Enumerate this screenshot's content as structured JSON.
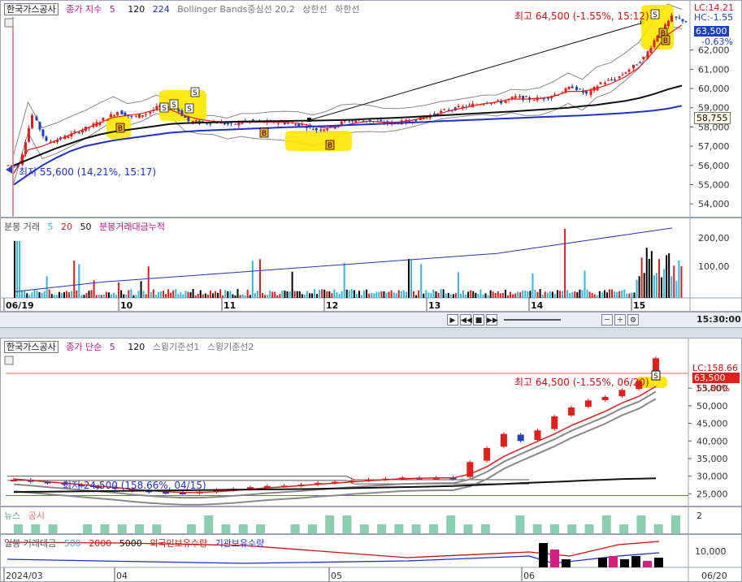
{
  "colors": {
    "up": "#e0201c",
    "down": "#1f3fbf",
    "ma5": "#e0201c",
    "ma120": "#111111",
    "ma224": "#1f2fcf",
    "bb": "#888888",
    "vol_up": "#d62020",
    "vol_down": "#000000",
    "vol_light": "#36b5d8",
    "cum": "#2233bb",
    "news": "#8ccfb0",
    "highlight": "#ffe800"
  },
  "top": {
    "legend": {
      "stock": "한국가스공사",
      "ma_label": "종가 지수",
      "p1": "5",
      "p2": "120",
      "p3": "224",
      "bb": "Bollinger Bands중심선 20,2",
      "upper": "상한선",
      "lower": "하한선"
    },
    "high_label": "최고 64,500 (-1.55%, 15:12)",
    "low_label": "최저 55,600 (14,21%, 15:17)",
    "lc": "LC:14.21",
    "hc": "HC:-1.55",
    "cur_price": "63,500",
    "cur_pct": "-0.63%",
    "ref_price": "58,755",
    "y_ticks": [
      "62,000",
      "61,000",
      "60,000",
      "59,000",
      "58,000",
      "57,000",
      "56,000",
      "55,000",
      "54,000"
    ],
    "x_ticks": [
      "06/19",
      "10",
      "11",
      "12",
      "13",
      "14",
      "15"
    ],
    "time_label": "15:30:00",
    "signal_s": "S",
    "signal_b": "B"
  },
  "vol": {
    "legend": {
      "name": "분봉 거래",
      "p1": "5",
      "p2": "20",
      "p3": "50",
      "cum": "분봉거래대금누적"
    },
    "y_ticks": [
      "200,00",
      "100,00"
    ]
  },
  "bottom": {
    "legend": {
      "stock": "한국가스공사",
      "ma_label": "종가 단순",
      "p1": "5",
      "p2": "120",
      "s1": "스윙기준선1",
      "s2": "스윙기준선2"
    },
    "high_label": "최고 64,500 (-1.55%, 06/20)",
    "low_label": "최저 24,500 (158.66%, 04/15)",
    "lc": "LC:158.66",
    "cur_price": "63,500",
    "cur_pct": "13.80%",
    "y_ticks": [
      "55,000",
      "50,000",
      "45,000",
      "40,000",
      "35,000",
      "30,000",
      "25,000"
    ],
    "x_ticks": [
      "2024/03",
      "04",
      "05",
      "06"
    ],
    "end_label": "06/20",
    "signal_s": "S"
  },
  "news": {
    "legend": {
      "news": "뉴스",
      "disc": "공시"
    },
    "y_tick": "2"
  },
  "dvol": {
    "legend": {
      "name": "일봉 거래대금",
      "p1": "500",
      "p2": "2000",
      "p3": "5000",
      "foreign": "외국인보유수량",
      "inst": "기관보유수량"
    },
    "y_tick": "10,000"
  },
  "chart_data": [
    {
      "type": "candlestick",
      "title": "한국가스공사 분봉",
      "x": [
        "06/19",
        "10",
        "11",
        "12",
        "13",
        "14",
        "15"
      ],
      "ylim": [
        53500,
        63800
      ],
      "series": [
        {
          "name": "종가",
          "values": [
            56000,
            58600,
            57200,
            57400,
            57700,
            58000,
            58400,
            58800,
            58500,
            58700,
            59100,
            59000,
            58300,
            58200,
            58250,
            58100,
            58300,
            58250,
            58250,
            58200,
            58100,
            57850,
            58000,
            58300,
            58350,
            58300,
            58200,
            58250,
            58400,
            58600,
            58850,
            59000,
            59150,
            59300,
            59300,
            59550,
            59450,
            59500,
            59750,
            60100,
            59700,
            60300,
            60500,
            61000,
            61600,
            62800,
            63700,
            63500
          ]
        },
        {
          "name": "5",
          "values": [
            55600,
            56800,
            57000,
            57300,
            57600,
            57900,
            58200,
            58500,
            58600,
            58700,
            58900,
            58900,
            58600,
            58400,
            58300,
            58250,
            58250,
            58250,
            58250,
            58250,
            58200,
            58050,
            57950,
            58050,
            58200,
            58300,
            58250,
            58250,
            58350,
            58500,
            58700,
            58900,
            59050,
            59200,
            59300,
            59450,
            59450,
            59480,
            59600,
            59850,
            59850,
            60000,
            60250,
            60600,
            61100,
            61900,
            62800,
            63300
          ]
        },
        {
          "name": "120",
          "values": [
            56000,
            56300,
            56600,
            56900,
            57150,
            57400,
            57600,
            57750,
            57850,
            57950,
            58050,
            58150,
            58200,
            58220,
            58240,
            58260,
            58280,
            58290,
            58300,
            58310,
            58320,
            58330,
            58340,
            58360,
            58380,
            58420,
            58450,
            58480,
            58520,
            58560,
            58600,
            58640,
            58680,
            58720,
            58760,
            58800,
            58850,
            58900,
            58950,
            59000,
            59080,
            59150,
            59250,
            59350,
            59500,
            59700,
            59950,
            60150
          ]
        },
        {
          "name": "224",
          "values": [
            55000,
            55500,
            56000,
            56400,
            56750,
            57000,
            57150,
            57300,
            57400,
            57500,
            57600,
            57700,
            57750,
            57800,
            57830,
            57860,
            57890,
            57920,
            57950,
            57980,
            58000,
            58020,
            58050,
            58080,
            58110,
            58140,
            58170,
            58200,
            58230,
            58260,
            58300,
            58330,
            58360,
            58390,
            58420,
            58450,
            58480,
            58510,
            58540,
            58570,
            58600,
            58640,
            58680,
            58720,
            58780,
            58850,
            58950,
            59100
          ]
        }
      ]
    },
    {
      "type": "bar",
      "title": "분봉 거래",
      "y_ticks": [
        100,
        200
      ],
      "series": [
        {
          "name": "분봉거래대금누적",
          "values": [
            20,
            35,
            50,
            60,
            70,
            80,
            90,
            100,
            110,
            120,
            130,
            140,
            160,
            180,
            200,
            220
          ]
        }
      ]
    },
    {
      "type": "candlestick",
      "title": "한국가스공사 일봉",
      "x": [
        "2024/03",
        "04",
        "05",
        "06",
        "06/20"
      ],
      "ylim": [
        23000,
        64500
      ],
      "series": [
        {
          "name": "종가",
          "values": [
            29000,
            28400,
            28100,
            27600,
            27100,
            26900,
            26400,
            25900,
            25500,
            25300,
            25200,
            25600,
            26100,
            26400,
            26900,
            27200,
            27300,
            27600,
            28100,
            28400,
            28800,
            29100,
            29300,
            29600,
            29500,
            29600,
            29300,
            34000,
            38000,
            42000,
            40000,
            43000,
            47000,
            49500,
            51500,
            52500,
            54500,
            57000,
            63500
          ]
        },
        {
          "name": "5",
          "values": [
            29200,
            28800,
            28400,
            28000,
            27600,
            27200,
            26800,
            26300,
            25900,
            25600,
            25400,
            25400,
            25600,
            25900,
            26300,
            26700,
            27000,
            27300,
            27700,
            28000,
            28400,
            28700,
            29000,
            29300,
            29400,
            29500,
            29500,
            30600,
            32700,
            35600,
            37800,
            39900,
            42000,
            44400,
            46400,
            48400,
            50800,
            52700,
            55500
          ]
        },
        {
          "name": "120",
          "values": [
            25500,
            25550,
            25600,
            25650,
            25700,
            25750,
            25800,
            25850,
            25900,
            25950,
            26000,
            26050,
            26100,
            26150,
            26200,
            26250,
            26300,
            26350,
            26400,
            26500,
            26600,
            26700,
            26800,
            26900,
            27000,
            27100,
            27200,
            27400,
            27600,
            27800,
            28000,
            28200,
            28400,
            28600,
            28800,
            29000,
            29200,
            29300,
            29400
          ]
        }
      ]
    },
    {
      "type": "bar",
      "title": "뉴스",
      "values": [
        1,
        1,
        1,
        0,
        1,
        1,
        1,
        1,
        1,
        0,
        1,
        2,
        1,
        1,
        1,
        0,
        1,
        1,
        2,
        2,
        1,
        1,
        1,
        1,
        1,
        2,
        1,
        1,
        0,
        2,
        1,
        1,
        1,
        1,
        2,
        1,
        2,
        1,
        2
      ]
    },
    {
      "type": "bar",
      "title": "일봉 거래대금",
      "series": [
        {
          "name": "외국인보유수량"
        },
        {
          "name": "기관보유수량"
        }
      ]
    }
  ]
}
